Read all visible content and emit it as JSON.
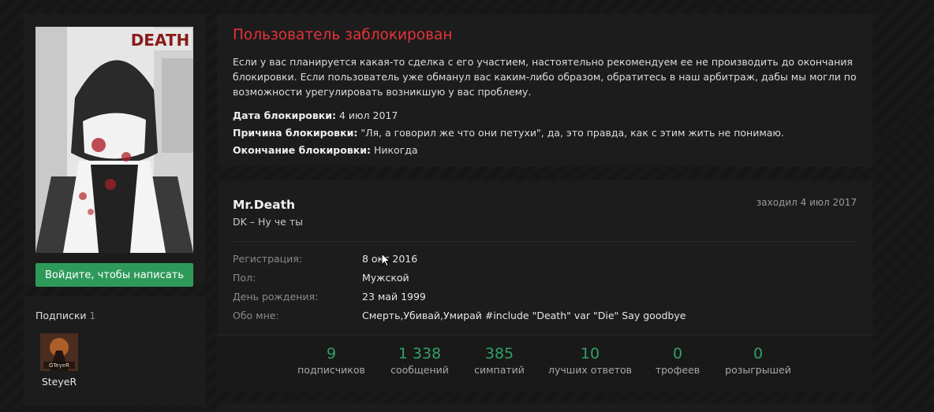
{
  "sidebar": {
    "avatar": {
      "logo_text": "DEATH"
    },
    "write_button": "Войдите, чтобы написать",
    "subscriptions": {
      "title": "Подписки",
      "count": "1",
      "users": [
        {
          "name": "SteyeR",
          "avatar_text": "GTeyeR"
        }
      ]
    }
  },
  "ban": {
    "title": "Пользователь заблокирован",
    "text": "Если у вас планируется какая-то сделка с его участием, настоятельно рекомендуем ее не производить до окончания блокировки. Если пользователь уже обманул вас каким-либо образом, обратитесь в наш арбитраж, дабы мы могли по возможности урегулировать возникшую у вас проблему.",
    "date_label": "Дата блокировки:",
    "date_value": "4 июл 2017",
    "reason_label": "Причина блокировки:",
    "reason_value": "\"Ля, а говорил же что они петухи\", да, это правда, как с этим жить не понимаю.",
    "end_label": "Окончание блокировки:",
    "end_value": "Никогда"
  },
  "profile": {
    "name": "Mr.Death",
    "status": "DK – Ну че ты",
    "last_seen": "заходил 4 июл 2017",
    "info": [
      {
        "label": "Регистрация:",
        "value": "8 окт 2016"
      },
      {
        "label": "Пол:",
        "value": "Мужской"
      },
      {
        "label": "День рождения:",
        "value": "23 май 1999"
      },
      {
        "label": "Обо мне:",
        "value": "Смерть,Убивай,Умирай #include \"Death\" var \"Die\" Say goodbye"
      }
    ]
  },
  "stats": [
    {
      "value": "9",
      "label": "подписчиков"
    },
    {
      "value": "1 338",
      "label": "сообщений"
    },
    {
      "value": "385",
      "label": "симпатий"
    },
    {
      "value": "10",
      "label": "лучших ответов"
    },
    {
      "value": "0",
      "label": "трофеев"
    },
    {
      "value": "0",
      "label": "розыгрышей"
    }
  ],
  "colors": {
    "accent_green": "#30a066",
    "button_green": "#2e9a5a",
    "ban_red": "#e5333a",
    "panel_bg": "#1c1c1c",
    "page_bg": "#161616"
  }
}
